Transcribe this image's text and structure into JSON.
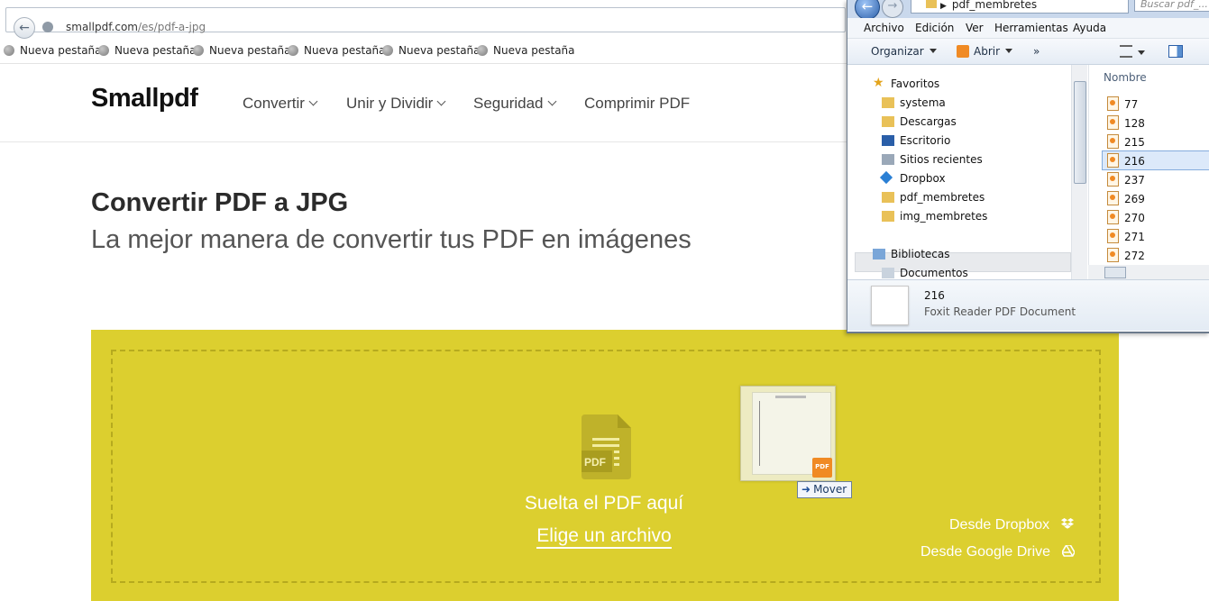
{
  "browser": {
    "url_host": "smallpdf.com",
    "url_path": "/es/pdf-a-jpg",
    "bookmarks": [
      "Nueva pestaña",
      "Nueva pestaña",
      "Nueva pestaña",
      "Nueva pestaña",
      "Nueva pestaña",
      "Nueva pestaña"
    ]
  },
  "site": {
    "logo": "Smallpdf",
    "nav": [
      "Convertir",
      "Unir y Dividir",
      "Seguridad",
      "Comprimir PDF"
    ],
    "title": "Convertir PDF a JPG",
    "subtitle": "La mejor manera de convertir tus PDF en imágenes",
    "dropzone": {
      "pdf_icon_label": "PDF",
      "drop_text": "Suelta el PDF aquí",
      "choose_file": "Elige un archivo",
      "dropbox_link": "Desde Dropbox",
      "gdrive_link": "Desde Google Drive",
      "color": "#dccf2f"
    }
  },
  "drag": {
    "tooltip": "Mover",
    "foxit_badge": "PDF"
  },
  "explorer": {
    "address": "pdf_membretes",
    "search_placeholder": "Buscar pdf_...",
    "menu": [
      "Archivo",
      "Edición",
      "Ver",
      "Herramientas",
      "Ayuda"
    ],
    "toolbar": {
      "organize": "Organizar",
      "open": "Abrir",
      "more": "»"
    },
    "nav_items": [
      {
        "label": "Favoritos",
        "icon": "star-icon"
      },
      {
        "label": "systema",
        "icon": "folder-icon"
      },
      {
        "label": "Descargas",
        "icon": "downloads-folder-icon"
      },
      {
        "label": "Escritorio",
        "icon": "desktop-icon"
      },
      {
        "label": "Sitios recientes",
        "icon": "recent-places-icon"
      },
      {
        "label": "Dropbox",
        "icon": "dropbox-icon"
      },
      {
        "label": "pdf_membretes",
        "icon": "folder-icon"
      },
      {
        "label": "img_membretes",
        "icon": "folder-icon"
      },
      {
        "label": "Bibliotecas",
        "icon": "libraries-icon"
      },
      {
        "label": "Documentos",
        "icon": "documents-icon"
      }
    ],
    "column_header": "Nombre",
    "files": [
      "77",
      "128",
      "215",
      "216",
      "237",
      "269",
      "270",
      "271",
      "272"
    ],
    "selected_file": "216",
    "details": {
      "name": "216",
      "type": "Foxit Reader PDF Document"
    }
  }
}
